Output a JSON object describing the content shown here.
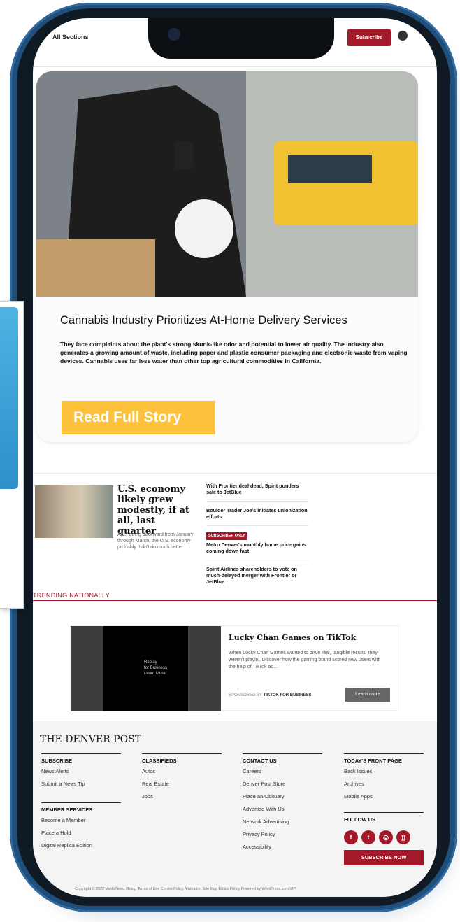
{
  "header": {
    "all_sections": "All Sections",
    "subscribe": "Subscribe"
  },
  "hero": {
    "title": "Cannabis Industry Prioritizes At-Home Delivery Services",
    "description": "They face complaints about the plant's strong skunk-like odor and potential to lower air quality. The industry also generates a growing amount of waste, including paper and plastic consumer packaging and electronic waste from vaping devices. Cannabis uses far less water than other top agricultural commodities in California.",
    "read_button": "Read Full Story"
  },
  "news": {
    "headline": "U.S. economy likely grew modestly, if at all, last quarter",
    "summary": "After going backward from January through March, the U.S. economy probably didn't do much better...",
    "side_items": [
      "With Frontier deal dead, Spirit ponders sale to JetBlue",
      "Boulder Trader Joe's initiates unionization efforts",
      "Metro Denver's monthly home price gains coming down fast",
      "Spirit Airlines shareholders to vote on much-delayed merger with Frontier or JetBlue"
    ],
    "badge": "SUBSCRIBER ONLY",
    "trending": "TRENDING NATIONALLY"
  },
  "ad": {
    "title": "Lucky Chan Games on TikTok",
    "description": "When Lucky Chan Games wanted to drive real, tangible results, they weren't playin'. Discover how the gaming brand scored new users with the help of TikTok ad...",
    "sponsor_prefix": "SPONSORED BY",
    "sponsor": "TIKTOK FOR BUSINESS",
    "learn_more": "Learn more",
    "video_text": [
      "Replay",
      "for Business",
      "Learn More"
    ]
  },
  "footer": {
    "logo": "THE DENVER POST",
    "subscribe_head": "SUBSCRIBE",
    "subscribe_links": [
      "News Alerts",
      "Submit a News Tip"
    ],
    "member_head": "MEMBER SERVICES",
    "member_links": [
      "Become a Member",
      "Place a Hold",
      "Digital Replica Edition"
    ],
    "classifieds_head": "CLASSIFIEDS",
    "classifieds_links": [
      "Autos",
      "Real Estate",
      "Jobs"
    ],
    "contact_head": "CONTACT US",
    "contact_links": [
      "Careers",
      "Denver Post Store",
      "Place an Obituary",
      "Advertise With Us",
      "Network Advertising",
      "Privacy Policy",
      "Accessibility"
    ],
    "today_head": "TODAY'S FRONT PAGE",
    "today_links": [
      "Back Issues",
      "Archives",
      "Mobile Apps"
    ],
    "follow_head": "FOLLOW US",
    "subscribe_now": "SUBSCRIBE NOW",
    "copyright": "Copyright © 2022 MediaNews Group   Terms of Use   Cookie Policy   Arbitration   Site Map   Ethics Policy   Powered by WordPress.com VIP"
  },
  "colors": {
    "brand_red": "#a3192a",
    "button_yellow": "#fdc23d",
    "frame_blue": "#1f4f7a"
  }
}
